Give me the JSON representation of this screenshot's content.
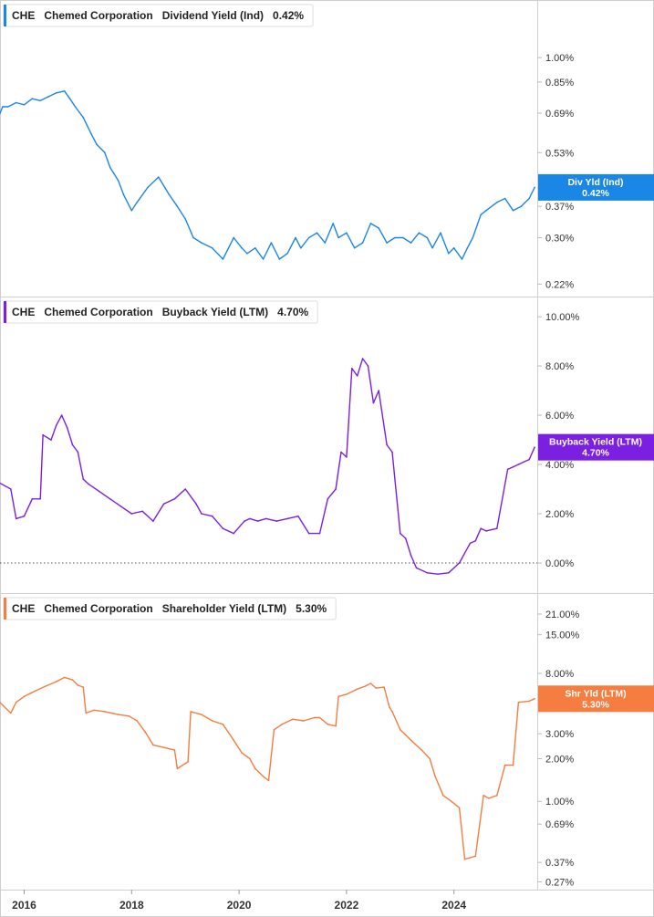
{
  "chart_data": [
    {
      "type": "line",
      "ticker": "CHE",
      "company": "Chemed Corporation",
      "metric": "Dividend Yield (Ind)",
      "current_value": "0.42%",
      "tag_label": "Div Yld (Ind)",
      "tag_value": "0.42%",
      "color": "#1a86e6",
      "scale": "log",
      "ylim": [
        0.21,
        1.35
      ],
      "y_ticks": [
        {
          "v": 1.0,
          "label": "1.00%"
        },
        {
          "v": 0.85,
          "label": "0.85%"
        },
        {
          "v": 0.69,
          "label": "0.69%"
        },
        {
          "v": 0.53,
          "label": "0.53%"
        },
        {
          "v": 0.37,
          "label": "0.37%"
        },
        {
          "v": 0.3,
          "label": "0.30%"
        },
        {
          "v": 0.22,
          "label": "0.22%"
        }
      ],
      "series": [
        {
          "x": [
            2015.5,
            2015.6,
            2015.7,
            2015.85,
            2016.0,
            2016.15,
            2016.3,
            2016.45,
            2016.6,
            2016.75,
            2016.85,
            2016.95,
            2017.1,
            2017.25,
            2017.35,
            2017.5,
            2017.6,
            2017.75,
            2017.85,
            2018.0,
            2018.1,
            2018.3,
            2018.5,
            2018.7,
            2018.85,
            2019.0,
            2019.15,
            2019.3,
            2019.5,
            2019.7,
            2019.9,
            2020.05,
            2020.15,
            2020.3,
            2020.45,
            2020.6,
            2020.75,
            2020.9,
            2021.05,
            2021.15,
            2021.3,
            2021.45,
            2021.6,
            2021.75,
            2021.85,
            2022.0,
            2022.15,
            2022.3,
            2022.45,
            2022.6,
            2022.75,
            2022.9,
            2023.05,
            2023.2,
            2023.35,
            2023.5,
            2023.6,
            2023.75,
            2023.9,
            2024.0,
            2024.15,
            2024.25,
            2024.35,
            2024.5,
            2024.6,
            2024.8,
            2024.95,
            2025.1,
            2025.25,
            2025.4,
            2025.5
          ],
          "y": [
            0.66,
            0.72,
            0.72,
            0.74,
            0.73,
            0.76,
            0.75,
            0.77,
            0.79,
            0.8,
            0.76,
            0.72,
            0.67,
            0.6,
            0.56,
            0.53,
            0.48,
            0.44,
            0.4,
            0.36,
            0.38,
            0.42,
            0.45,
            0.4,
            0.37,
            0.34,
            0.3,
            0.29,
            0.28,
            0.26,
            0.3,
            0.28,
            0.27,
            0.28,
            0.26,
            0.29,
            0.26,
            0.27,
            0.3,
            0.28,
            0.3,
            0.31,
            0.29,
            0.33,
            0.3,
            0.31,
            0.28,
            0.29,
            0.33,
            0.32,
            0.29,
            0.3,
            0.3,
            0.29,
            0.31,
            0.3,
            0.28,
            0.31,
            0.27,
            0.28,
            0.26,
            0.28,
            0.3,
            0.35,
            0.36,
            0.38,
            0.39,
            0.36,
            0.37,
            0.39,
            0.42
          ]
        }
      ]
    },
    {
      "type": "line",
      "ticker": "CHE",
      "company": "Chemed Corporation",
      "metric": "Buyback Yield (LTM)",
      "current_value": "4.70%",
      "tag_label": "Buyback Yield (LTM)",
      "tag_value": "4.70%",
      "color": "#7b1fe0",
      "scale": "linear",
      "ylim": [
        -1.0,
        10.3
      ],
      "zero_line": true,
      "y_ticks": [
        {
          "v": 10,
          "label": "10.00%"
        },
        {
          "v": 8,
          "label": "8.00%"
        },
        {
          "v": 6,
          "label": "6.00%"
        },
        {
          "v": 4,
          "label": "4.00%"
        },
        {
          "v": 2,
          "label": "2.00%"
        },
        {
          "v": 0,
          "label": "0.00%"
        }
      ],
      "series": [
        {
          "x": [
            2015.5,
            2015.75,
            2015.85,
            2016.0,
            2016.15,
            2016.3,
            2016.35,
            2016.5,
            2016.6,
            2016.7,
            2016.8,
            2016.9,
            2017.0,
            2017.1,
            2017.2,
            2017.4,
            2017.6,
            2017.8,
            2018.0,
            2018.2,
            2018.4,
            2018.6,
            2018.8,
            2019.0,
            2019.2,
            2019.3,
            2019.5,
            2019.7,
            2019.9,
            2020.1,
            2020.2,
            2020.35,
            2020.5,
            2020.7,
            2020.9,
            2021.1,
            2021.3,
            2021.5,
            2021.65,
            2021.8,
            2021.9,
            2022.0,
            2022.1,
            2022.2,
            2022.3,
            2022.4,
            2022.5,
            2022.6,
            2022.75,
            2022.85,
            2023.0,
            2023.1,
            2023.2,
            2023.3,
            2023.5,
            2023.7,
            2023.9,
            2024.1,
            2024.3,
            2024.4,
            2024.5,
            2024.6,
            2024.8,
            2025.0,
            2025.1,
            2025.2,
            2025.3,
            2025.4,
            2025.5
          ],
          "y": [
            3.3,
            3.0,
            1.8,
            1.9,
            2.6,
            2.6,
            5.2,
            5.0,
            5.6,
            6.0,
            5.5,
            4.8,
            4.5,
            3.4,
            3.2,
            2.9,
            2.6,
            2.3,
            2.0,
            2.1,
            1.7,
            2.4,
            2.6,
            3.0,
            2.4,
            2.0,
            1.9,
            1.4,
            1.2,
            1.7,
            1.8,
            1.7,
            1.8,
            1.7,
            1.8,
            1.9,
            1.2,
            1.2,
            2.6,
            3.0,
            4.5,
            4.3,
            7.9,
            7.6,
            8.3,
            8.0,
            6.5,
            7.0,
            4.8,
            4.5,
            1.2,
            1.0,
            0.3,
            -0.2,
            -0.4,
            -0.45,
            -0.4,
            0.0,
            0.8,
            0.9,
            1.4,
            1.3,
            1.4,
            3.8,
            3.9,
            4.0,
            4.1,
            4.2,
            4.7
          ]
        }
      ]
    },
    {
      "type": "line",
      "ticker": "CHE",
      "company": "Chemed Corporation",
      "metric": "Shareholder Yield (LTM)",
      "current_value": "5.30%",
      "tag_label": "Shr Yld (LTM)",
      "tag_value": "5.30%",
      "color": "#f47d3f",
      "scale": "log",
      "ylim": [
        0.26,
        24
      ],
      "y_ticks": [
        {
          "v": 21,
          "label": "21.00%"
        },
        {
          "v": 15,
          "label": "15.00%"
        },
        {
          "v": 8,
          "label": "8.00%"
        },
        {
          "v": 3,
          "label": "3.00%"
        },
        {
          "v": 2,
          "label": "2.00%"
        },
        {
          "v": 1,
          "label": "1.00%"
        },
        {
          "v": 0.69,
          "label": "0.69%"
        },
        {
          "v": 0.37,
          "label": "0.37%"
        },
        {
          "v": 0.27,
          "label": "0.27%"
        }
      ],
      "series": [
        {
          "x": [
            2015.5,
            2015.75,
            2015.85,
            2016.0,
            2016.2,
            2016.4,
            2016.6,
            2016.75,
            2016.9,
            2017.0,
            2017.1,
            2017.15,
            2017.3,
            2017.5,
            2017.75,
            2017.95,
            2018.1,
            2018.25,
            2018.4,
            2018.6,
            2018.8,
            2018.85,
            2019.05,
            2019.1,
            2019.3,
            2019.5,
            2019.7,
            2019.9,
            2020.05,
            2020.2,
            2020.3,
            2020.45,
            2020.55,
            2020.65,
            2020.8,
            2021.0,
            2021.2,
            2021.4,
            2021.5,
            2021.65,
            2021.8,
            2021.85,
            2022.0,
            2022.2,
            2022.35,
            2022.45,
            2022.55,
            2022.7,
            2022.8,
            2022.85,
            2023.0,
            2023.2,
            2023.4,
            2023.55,
            2023.65,
            2023.8,
            2023.95,
            2024.1,
            2024.2,
            2024.3,
            2024.4,
            2024.55,
            2024.65,
            2024.8,
            2024.95,
            2025.1,
            2025.2,
            2025.4,
            2025.5
          ],
          "y": [
            5.2,
            4.2,
            5.0,
            5.5,
            6.0,
            6.5,
            7.0,
            7.5,
            7.2,
            6.6,
            6.4,
            4.2,
            4.4,
            4.3,
            4.1,
            4.0,
            3.7,
            3.1,
            2.5,
            2.4,
            2.3,
            1.7,
            1.9,
            4.3,
            4.1,
            3.7,
            3.5,
            2.7,
            2.2,
            2.0,
            1.7,
            1.5,
            1.4,
            3.2,
            3.5,
            3.8,
            3.7,
            3.9,
            3.9,
            3.5,
            3.4,
            5.5,
            5.7,
            6.2,
            6.5,
            6.8,
            6.3,
            6.4,
            4.6,
            4.3,
            3.2,
            2.7,
            2.3,
            2.0,
            1.5,
            1.1,
            1.0,
            0.9,
            0.39,
            0.4,
            0.41,
            1.1,
            1.05,
            1.1,
            1.8,
            1.8,
            5.0,
            5.1,
            5.3
          ]
        }
      ]
    }
  ],
  "x_axis": {
    "ticks": [
      {
        "v": 2016,
        "label": "2016"
      },
      {
        "v": 2018,
        "label": "2018"
      },
      {
        "v": 2020,
        "label": "2020"
      },
      {
        "v": 2022,
        "label": "2022"
      },
      {
        "v": 2024,
        "label": "2024"
      }
    ],
    "xlim": [
      2015.55,
      2025.55
    ]
  }
}
